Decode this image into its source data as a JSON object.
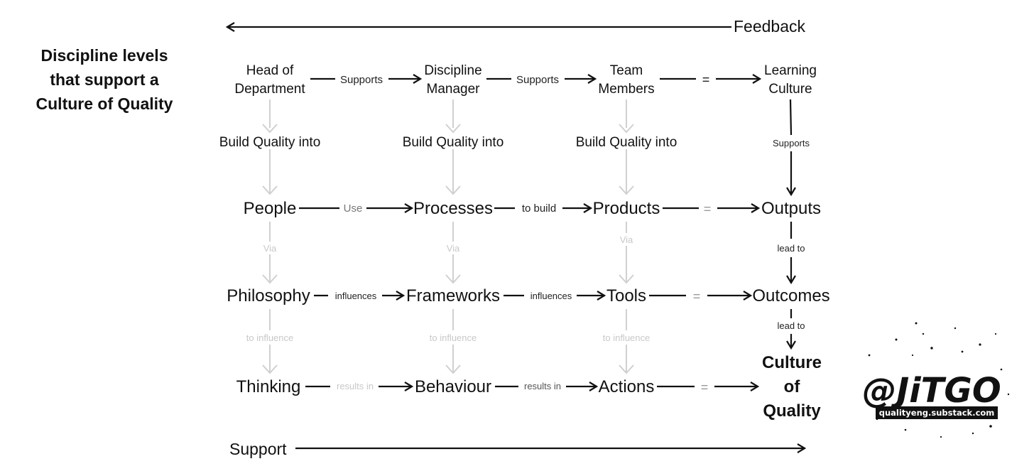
{
  "title": [
    "Discipline levels",
    "that support a",
    "Culture of Quality"
  ],
  "feedback_label": "Feedback",
  "support_label": "Support",
  "row1": {
    "nodes": [
      [
        "Head of",
        "Department"
      ],
      [
        "Discipline",
        "Manager"
      ],
      [
        "Team",
        "Members"
      ],
      [
        "Learning",
        "Culture"
      ]
    ],
    "edges": [
      "Supports",
      "Supports",
      "="
    ]
  },
  "build_quality": "Build Quality into",
  "learning_supports": "Supports",
  "row2": {
    "nodes": [
      "People",
      "Processes",
      "Products",
      "Outputs"
    ],
    "edges": [
      "Use",
      "to build",
      "="
    ]
  },
  "via": "Via",
  "lead_to": "lead to",
  "row3": {
    "nodes": [
      "Philosophy",
      "Frameworks",
      "Tools",
      "Outcomes"
    ],
    "edges": [
      "influences",
      "influences",
      "="
    ]
  },
  "to_influence": "to influence",
  "row4": {
    "nodes": [
      "Thinking",
      "Behaviour",
      "Actions"
    ],
    "edges": [
      "results in",
      "results in",
      "="
    ]
  },
  "final": [
    "Culture",
    "of",
    "Quality"
  ],
  "logo": {
    "handle": "@JiTGO",
    "url": "qualityeng.substack.com"
  },
  "colors": {
    "ink": "#111111",
    "muted": "#c8c8c8"
  }
}
